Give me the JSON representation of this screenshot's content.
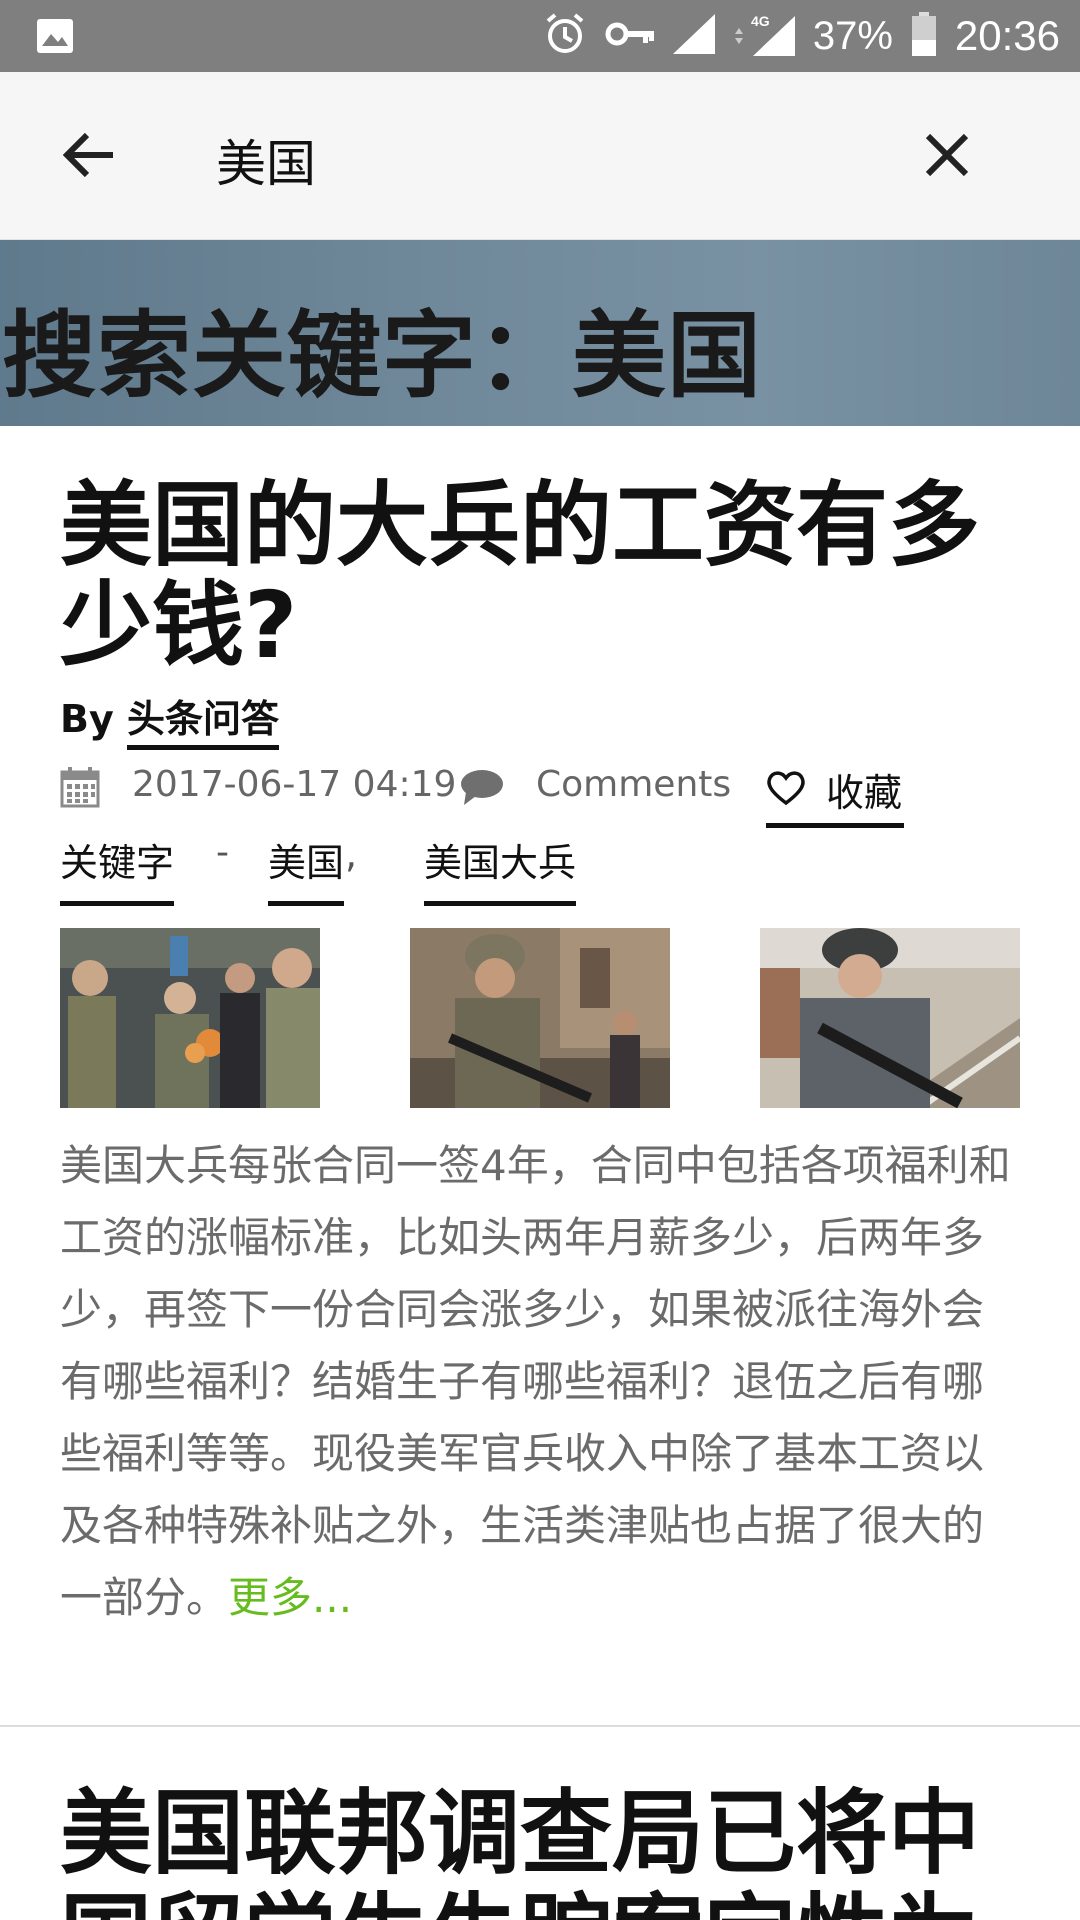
{
  "status_bar": {
    "battery_percent": "37%",
    "time": "20:36",
    "network": "4G"
  },
  "search": {
    "query": "美国",
    "back_icon": "arrow-left-icon",
    "clear_icon": "close-icon"
  },
  "banner": {
    "title": "搜索关键字：美国"
  },
  "article": {
    "title": "美国的大兵的工资有多少钱?",
    "by_label": "By",
    "author": "头条问答",
    "date": "2017-06-17 04:19",
    "comments_label": "Comments",
    "favorite_label": "收藏",
    "tags_label": "关键字",
    "tags_separator": "-",
    "tags": [
      "美国",
      "美国大兵"
    ],
    "tag_comma": ",",
    "excerpt": "美国大兵每张合同一签4年，合同中包括各项福利和工资的涨幅标准，比如头两年月薪多少，后两年多少，再签下一份合同会涨多少，如果被派往海外会有哪些福利？结婚生子有哪些福利？退伍之后有哪些福利等等。现役美军官兵收入中除了基本工资以及各种特殊补贴之外，生活类津贴也占据了很大的一部分。",
    "more_label": "更多..."
  },
  "next_article": {
    "title": "美国联邦调查局已将中国留学生失踪案定性为"
  }
}
